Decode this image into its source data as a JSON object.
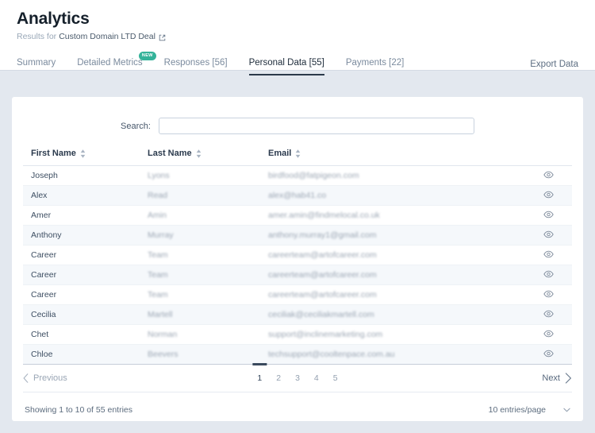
{
  "header": {
    "title": "Analytics",
    "subtitle_prefix": "Results for",
    "subtitle_entity": "Custom Domain LTD Deal",
    "external_link_icon": "external-link-icon"
  },
  "tabs": [
    {
      "label": "Summary",
      "active": false,
      "badge": null
    },
    {
      "label": "Detailed Metrics",
      "active": false,
      "badge": "NEW"
    },
    {
      "label": "Responses [56]",
      "active": false,
      "badge": null
    },
    {
      "label": "Personal Data [55]",
      "active": true,
      "badge": null
    },
    {
      "label": "Payments [22]",
      "active": false,
      "badge": null
    }
  ],
  "export_label": "Export Data",
  "search": {
    "label": "Search:",
    "value": "",
    "placeholder": ""
  },
  "table": {
    "columns": [
      {
        "label": "First Name",
        "sortable": true
      },
      {
        "label": "Last Name",
        "sortable": true
      },
      {
        "label": "Email",
        "sortable": true
      },
      {
        "label": "",
        "sortable": false
      }
    ],
    "rows": [
      {
        "first_name": "Joseph",
        "last_name": "Lyons",
        "email": "birdfood@fatpigeon.com",
        "action_icon": "eye-icon"
      },
      {
        "first_name": "Alex",
        "last_name": "Read",
        "email": "alex@hab41.co",
        "action_icon": "eye-icon"
      },
      {
        "first_name": "Amer",
        "last_name": "Amin",
        "email": "amer.amin@findmelocal.co.uk",
        "action_icon": "eye-icon"
      },
      {
        "first_name": "Anthony",
        "last_name": "Murray",
        "email": "anthony.murray1@gmail.com",
        "action_icon": "eye-icon"
      },
      {
        "first_name": "Career",
        "last_name": "Team",
        "email": "careerteam@artofcareer.com",
        "action_icon": "eye-icon"
      },
      {
        "first_name": "Career",
        "last_name": "Team",
        "email": "careerteam@artofcareer.com",
        "action_icon": "eye-icon"
      },
      {
        "first_name": "Career",
        "last_name": "Team",
        "email": "careerteam@artofcareer.com",
        "action_icon": "eye-icon"
      },
      {
        "first_name": "Cecilia",
        "last_name": "Martell",
        "email": "ceciliak@ceciliakmartell.com",
        "action_icon": "eye-icon"
      },
      {
        "first_name": "Chet",
        "last_name": "Norman",
        "email": "support@inclinemarketing.com",
        "action_icon": "eye-icon"
      },
      {
        "first_name": "Chloe",
        "last_name": "Beevers",
        "email": "techsupport@cooltenpace.com.au",
        "action_icon": "eye-icon"
      }
    ]
  },
  "pagination": {
    "previous_label": "Previous",
    "next_label": "Next",
    "pages": [
      "1",
      "2",
      "3",
      "4",
      "5"
    ],
    "active_page": "1"
  },
  "footer": {
    "showing_text": "Showing 1 to 10 of 55 entries",
    "entries_per_page": "10 entries/page"
  },
  "colors": {
    "page_background": "#e3e8ef",
    "card_background": "#ffffff",
    "accent_badge": "#34b39a",
    "active_tab": "#1d2b3a",
    "muted_text": "#9aa8b8"
  }
}
